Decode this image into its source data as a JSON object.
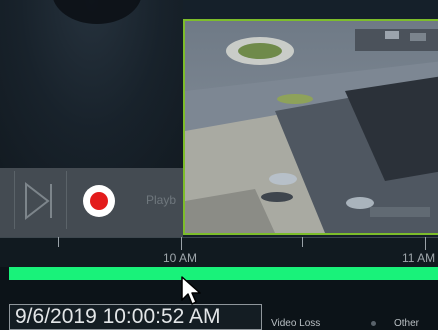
{
  "controls": {
    "mode_label": "Playb"
  },
  "timeline": {
    "ticks": [
      "10 AM",
      "11 AM"
    ],
    "bar_color": "#19f27a"
  },
  "footer": {
    "datetime": "9/6/2019 10:00:52 AM",
    "legend": [
      {
        "label": "Video Loss"
      },
      {
        "label": "Other"
      }
    ]
  },
  "camera": {
    "border_color": "#7dbd2b"
  },
  "icons": {
    "skip": "skip-next-icon",
    "record": "record-icon",
    "cursor": "mouse-pointer-icon"
  }
}
